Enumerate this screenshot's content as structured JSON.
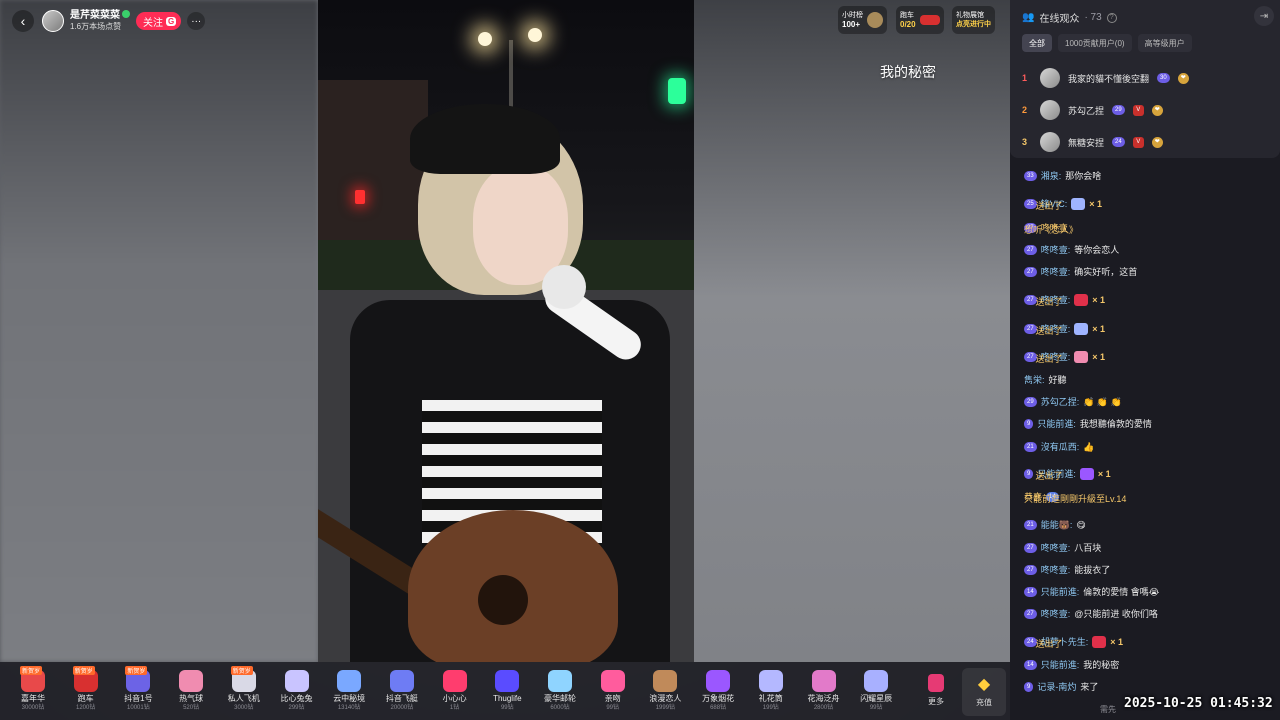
{
  "host": {
    "name": "是芹菜菜菜",
    "sub": "1.6万本场点赞",
    "follow_label": "关注",
    "follow_badge": "G",
    "more": "···"
  },
  "widgets": [
    {
      "title": "小时榜",
      "value": "100+",
      "accent": false
    },
    {
      "title": "跑车",
      "value": "0/20",
      "accent": true
    },
    {
      "title": "礼物展馆",
      "value": "点亮进行中",
      "accent": true
    }
  ],
  "song_overlay": "我的秘密",
  "gifts": [
    {
      "name": "嘉年华",
      "price": "30000钻",
      "tag": "新贺岁",
      "color": "#e8494a"
    },
    {
      "name": "跑车",
      "price": "1200钻",
      "tag": "新贺岁",
      "color": "#d83030"
    },
    {
      "name": "抖音1号",
      "price": "10001钻",
      "tag": "新贺岁",
      "color": "#6c63e6"
    },
    {
      "name": "热气球",
      "price": "520钻",
      "tag": "",
      "color": "#f08cb0"
    },
    {
      "name": "私人飞机",
      "price": "3000钻",
      "tag": "新贺岁",
      "color": "#d9d9e6"
    },
    {
      "name": "比心兔兔",
      "price": "299钻",
      "tag": "",
      "color": "#c9c4ff"
    },
    {
      "name": "云中秘境",
      "price": "13140钻",
      "tag": "",
      "color": "#7aa8ff"
    },
    {
      "name": "抖音飞艇",
      "price": "20000钻",
      "tag": "",
      "color": "#6e7cf4"
    },
    {
      "name": "小心心",
      "price": "1钻",
      "tag": "",
      "color": "#ff3d6e"
    },
    {
      "name": "Thuglife",
      "price": "99钻",
      "tag": "",
      "color": "#5a4cff"
    },
    {
      "name": "豪华邮轮",
      "price": "6000钻",
      "tag": "",
      "color": "#8fd4ff"
    },
    {
      "name": "亲吻",
      "price": "99钻",
      "tag": "",
      "color": "#ff5c9d"
    },
    {
      "name": "浪漫恋人",
      "price": "1999钻",
      "tag": "",
      "color": "#c08a5a"
    },
    {
      "name": "万象烟花",
      "price": "688钻",
      "tag": "",
      "color": "#9b57ff"
    },
    {
      "name": "礼花筒",
      "price": "199钻",
      "tag": "",
      "color": "#b4b8ff"
    },
    {
      "name": "花海泛舟",
      "price": "2800钻",
      "tag": "",
      "color": "#e27ac9"
    },
    {
      "name": "闪耀星辰",
      "price": "99钻",
      "tag": "",
      "color": "#a8b0ff"
    }
  ],
  "more_gifts": "更多",
  "recharge": "充值",
  "panel": {
    "title": "在线观众",
    "count": "· 73",
    "tabs": [
      "全部",
      "1000贡献用户(0)",
      "高等级用户"
    ],
    "ranking": [
      {
        "rank": "1",
        "name": "我家的貓不懂後空翻",
        "level": "30",
        "v": false
      },
      {
        "rank": "2",
        "name": "苏勾乙捏",
        "level": "29",
        "v": true
      },
      {
        "rank": "3",
        "name": "無糖安捏",
        "level": "24",
        "v": true
      }
    ]
  },
  "chat": [
    {
      "level": "33",
      "user": "湘泉:",
      "text": "那你会啥",
      "type": "text"
    },
    {
      "level": "25",
      "user": "锋VIC:",
      "text": "送出了",
      "type": "gift",
      "mult": "× 1",
      "color": "#9fb4ff"
    },
    {
      "level": "27",
      "user": "咚咚壹",
      "text": "想听《恋人》",
      "type": "goldtext"
    },
    {
      "level": "27",
      "user": "咚咚壹:",
      "text": "等你会恋人",
      "type": "text"
    },
    {
      "level": "27",
      "user": "咚咚壹:",
      "text": "确实好听，这首",
      "type": "text"
    },
    {
      "level": "27",
      "user": "咚咚壹:",
      "text": "送出了",
      "type": "gift",
      "mult": "× 1",
      "color": "#e0304a"
    },
    {
      "level": "27",
      "user": "咚咚壹:",
      "text": "送出了",
      "type": "gift",
      "mult": "× 1",
      "color": "#9fb4ff"
    },
    {
      "level": "27",
      "user": "咚咚壹:",
      "text": "送出了",
      "type": "gift",
      "mult": "× 1",
      "color": "#f08cb0"
    },
    {
      "level": "",
      "user": "雋栄:",
      "text": "好聽",
      "type": "text"
    },
    {
      "level": "29",
      "user": "苏勾乙捏:",
      "text": "👏 👏 👏",
      "type": "text"
    },
    {
      "level": "9",
      "user": "只能前進:",
      "text": "我想聽倫敦的愛情",
      "type": "text"
    },
    {
      "level": "21",
      "user": "沒有瓜西:",
      "text": "👍",
      "type": "text"
    },
    {
      "level": "9",
      "user": "只能前進:",
      "text": "送出了",
      "type": "gift",
      "mult": "× 1",
      "color": "#9b57ff"
    },
    {
      "level": "14",
      "user": "恭喜",
      "text": "只能前進剛剛升級至Lv.14",
      "type": "levelup"
    },
    {
      "level": "21",
      "user": "能能🐻:",
      "text": "😋",
      "type": "text"
    },
    {
      "level": "27",
      "user": "咚咚壹:",
      "text": "八百块",
      "type": "text"
    },
    {
      "level": "27",
      "user": "咚咚壹:",
      "text": "能拔衣了",
      "type": "text"
    },
    {
      "level": "14",
      "user": "只能前進:",
      "text": "倫敦的愛情 會嗎😭",
      "type": "text"
    },
    {
      "level": "27",
      "user": "咚咚壹:",
      "text": "@只能前进 收你们咯",
      "type": "text"
    },
    {
      "level": "24",
      "user": "胡萝卜先生:",
      "text": "送出了",
      "type": "gift",
      "mult": "× 1",
      "color": "#e0304a"
    },
    {
      "level": "14",
      "user": "只能前進:",
      "text": "我的秘密",
      "type": "text"
    },
    {
      "level": "9",
      "user": "记录-南灼",
      "text": "来了",
      "type": "text"
    }
  ],
  "footer_hint": "需先",
  "timestamp": "2025-10-25 01:45:32"
}
